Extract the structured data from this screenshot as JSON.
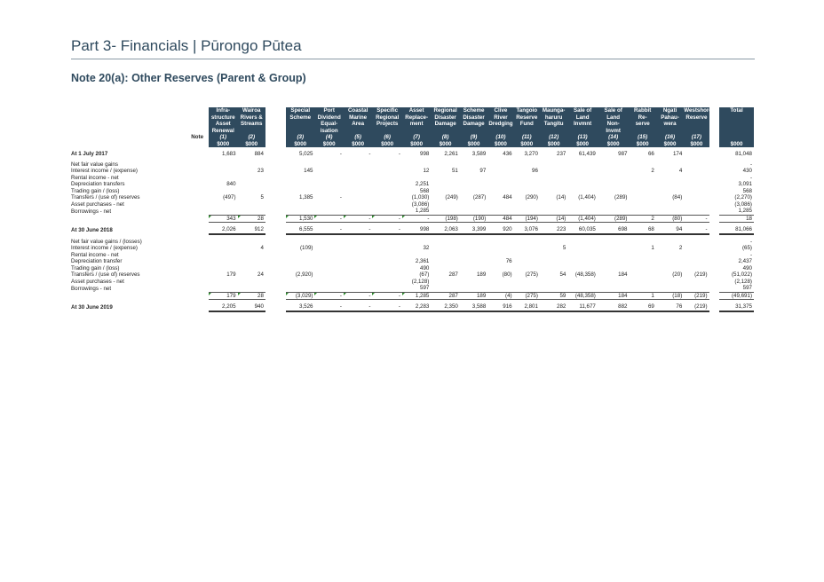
{
  "page_title": "Part 3- Financials | Pūrongo Pūtea",
  "note_title": "Note 20(a):  Other Reserves (Parent & Group)",
  "note_label": "Note",
  "columns": [
    {
      "h1": "Infra-",
      "h2": "structure",
      "h3": "Asset",
      "h4": "Renewal",
      "no": "(1)",
      "unit": "$000"
    },
    {
      "h1": "Wairoa",
      "h2": "Rivers &",
      "h3": "Streams",
      "h4": "",
      "no": "(2)",
      "unit": "$000"
    },
    {
      "h1": "Special",
      "h2": "Scheme",
      "h3": "",
      "h4": "",
      "no": "(3)",
      "unit": "$000"
    },
    {
      "h1": "Port",
      "h2": "Dividend",
      "h3": "Equal-",
      "h4": "isation",
      "no": "(4)",
      "unit": "$000"
    },
    {
      "h1": "Coastal",
      "h2": "Marine",
      "h3": "Area",
      "h4": "",
      "no": "(5)",
      "unit": "$000"
    },
    {
      "h1": "Specific",
      "h2": "Regional",
      "h3": "Projects",
      "h4": "",
      "no": "(6)",
      "unit": "$000"
    },
    {
      "h1": "Asset",
      "h2": "Replace-",
      "h3": "ment",
      "h4": "",
      "no": "(7)",
      "unit": "$000"
    },
    {
      "h1": "Regional",
      "h2": "Disaster",
      "h3": "Damage",
      "h4": "",
      "no": "(8)",
      "unit": "$000"
    },
    {
      "h1": "Scheme",
      "h2": "Disaster",
      "h3": "Damage",
      "h4": "",
      "no": "(9)",
      "unit": "$000"
    },
    {
      "h1": "Clive",
      "h2": "River",
      "h3": "Dredging",
      "h4": "",
      "no": "(10)",
      "unit": "$000"
    },
    {
      "h1": "Tangoio",
      "h2": "Reserve",
      "h3": "Fund",
      "h4": "",
      "no": "(11)",
      "unit": "$000"
    },
    {
      "h1": "Maunga-",
      "h2": "haruru",
      "h3": "Tangitu",
      "h4": "",
      "no": "(12)",
      "unit": "$000"
    },
    {
      "h1": "Sale of",
      "h2": "Land",
      "h3": "Invmnt",
      "h4": "",
      "no": "(13)",
      "unit": "$000"
    },
    {
      "h1": "Sale of",
      "h2": "Land",
      "h3": "Non-",
      "h4": "Invmt",
      "no": "(14)",
      "unit": "$000"
    },
    {
      "h1": "Rabbit",
      "h2": "Re-",
      "h3": "serve",
      "h4": "",
      "no": "(15)",
      "unit": "$000"
    },
    {
      "h1": "Ngati",
      "h2": "Pahau-",
      "h3": "wera",
      "h4": "",
      "no": "(16)",
      "unit": "$000"
    },
    {
      "h1": "Westshore",
      "h2": "Reserve",
      "h3": "",
      "h4": "",
      "no": "(17)",
      "unit": "$000"
    },
    {
      "h1": "Total",
      "h2": "",
      "h3": "",
      "h4": "",
      "no": "",
      "unit": "$000"
    }
  ],
  "rows": [
    {
      "type": "open",
      "label": "At 1 July 2017",
      "v": [
        "1,683",
        "884",
        "5,025",
        "-",
        "-",
        "-",
        "998",
        "2,261",
        "3,589",
        "436",
        "3,270",
        "237",
        "61,439",
        "987",
        "66",
        "174",
        "",
        "81,048"
      ]
    },
    {
      "type": "spacer"
    },
    {
      "type": "item",
      "label": "Net fair value gains",
      "v": [
        "",
        "",
        "",
        "",
        "",
        "",
        "",
        "",
        "",
        "",
        "",
        "",
        "",
        "",
        "",
        "",
        "",
        "-"
      ]
    },
    {
      "type": "item",
      "label": "Interest income / (expense)",
      "v": [
        "",
        "23",
        "145",
        "",
        "",
        "",
        "12",
        "51",
        "97",
        "",
        "96",
        "",
        "",
        "",
        "2",
        "4",
        "",
        "430"
      ]
    },
    {
      "type": "item",
      "label": "Rental income - net",
      "v": [
        "",
        "",
        "",
        "",
        "",
        "",
        "",
        "",
        "",
        "",
        "",
        "",
        "",
        "",
        "",
        "",
        "",
        "-"
      ]
    },
    {
      "type": "item",
      "label": "Depreciation transfers",
      "v": [
        "840",
        "",
        "",
        "",
        "",
        "",
        "2,251",
        "",
        "",
        "",
        "",
        "",
        "",
        "",
        "",
        "",
        "",
        "3,091"
      ]
    },
    {
      "type": "item",
      "label": "Trading gain / (loss)",
      "v": [
        "",
        "",
        "",
        "",
        "",
        "",
        "568",
        "",
        "",
        "",
        "",
        "",
        "",
        "",
        "",
        "",
        "",
        "568"
      ]
    },
    {
      "type": "item",
      "label": "Transfers / (use of) reserves",
      "v": [
        "(497)",
        "5",
        "1,385",
        "-",
        "",
        "",
        "(1,030)",
        "(249)",
        "(287)",
        "484",
        "(290)",
        "(14)",
        "(1,404)",
        "(289)",
        "",
        "(84)",
        "",
        "(2,270)"
      ]
    },
    {
      "type": "item",
      "label": "Asset purchases - net",
      "v": [
        "",
        "",
        "",
        "",
        "",
        "",
        "(3,086)",
        "",
        "",
        "",
        "",
        "",
        "",
        "",
        "",
        "",
        "",
        "(3,086)"
      ]
    },
    {
      "type": "item",
      "label": "Borrowings - net",
      "v": [
        "",
        "",
        "",
        "",
        "",
        "",
        "1,285",
        "",
        "",
        "",
        "",
        "",
        "",
        "",
        "",
        "",
        "",
        "1,285"
      ]
    },
    {
      "type": "sub",
      "label": "",
      "v": [
        "343",
        "28",
        "1,530",
        "-",
        "-",
        "-",
        "-",
        "(198)",
        "(190)",
        "484",
        "(194)",
        "(14)",
        "(1,404)",
        "(289)",
        "2",
        "(80)",
        "-",
        "18"
      ]
    },
    {
      "type": "spacer"
    },
    {
      "type": "tot",
      "label": "At 30 June 2018",
      "v": [
        "2,026",
        "912",
        "6,555",
        "-",
        "-",
        "-",
        "998",
        "2,063",
        "3,399",
        "920",
        "3,076",
        "223",
        "60,035",
        "698",
        "68",
        "94",
        "-",
        "81,066"
      ]
    },
    {
      "type": "spacer"
    },
    {
      "type": "item",
      "label": "Net fair value gains / (losses)",
      "v": [
        "",
        "",
        "",
        "",
        "",
        "",
        "",
        "",
        "",
        "",
        "",
        "",
        "",
        "",
        "",
        "",
        "",
        "-"
      ]
    },
    {
      "type": "item",
      "label": "Interest income / (expense)",
      "v": [
        "",
        "4",
        "(109)",
        "",
        "",
        "",
        "32",
        "",
        "",
        "",
        "",
        "5",
        "",
        "",
        "1",
        "2",
        "",
        "(65)"
      ]
    },
    {
      "type": "item",
      "label": "Rental income - net",
      "v": [
        "",
        "",
        "",
        "",
        "",
        "",
        "",
        "",
        "",
        "",
        "",
        "",
        "",
        "",
        "",
        "",
        "",
        "-"
      ]
    },
    {
      "type": "item",
      "label": "Depreciation transfer",
      "v": [
        "",
        "",
        "",
        "",
        "",
        "",
        "2,361",
        "",
        "",
        "76",
        "",
        "",
        "",
        "",
        "",
        "",
        "",
        "2,437"
      ]
    },
    {
      "type": "item",
      "label": "Trading gain / (loss)",
      "v": [
        "",
        "",
        "",
        "",
        "",
        "",
        "490",
        "",
        "",
        "",
        "",
        "",
        "",
        "",
        "",
        "",
        "",
        "490"
      ]
    },
    {
      "type": "item",
      "label": "Transfers / (use of) reserves",
      "v": [
        "179",
        "24",
        "(2,920)",
        "",
        "",
        "",
        "(67)",
        "287",
        "189",
        "(80)",
        "(275)",
        "54",
        "(48,358)",
        "184",
        "",
        "(20)",
        "(219)",
        "(51,022)"
      ]
    },
    {
      "type": "item",
      "label": "Asset purchases - net",
      "v": [
        "",
        "",
        "",
        "",
        "",
        "",
        "(2,128)",
        "",
        "",
        "",
        "",
        "",
        "",
        "",
        "",
        "",
        "",
        "(2,128)"
      ]
    },
    {
      "type": "item",
      "label": "Borrowings - net",
      "v": [
        "",
        "",
        "",
        "",
        "",
        "",
        "597",
        "",
        "",
        "",
        "",
        "",
        "",
        "",
        "",
        "",
        "",
        "597"
      ]
    },
    {
      "type": "sub",
      "label": "",
      "v": [
        "179",
        "28",
        "(3,029)",
        "-",
        "-",
        "-",
        "1,285",
        "287",
        "189",
        "(4)",
        "(275)",
        "59",
        "(48,358)",
        "184",
        "1",
        "(18)",
        "(219)",
        "(49,691)"
      ]
    },
    {
      "type": "spacer"
    },
    {
      "type": "tot",
      "label": "At 30 June 2019",
      "v": [
        "2,205",
        "940",
        "3,526",
        "-",
        "-",
        "-",
        "2,283",
        "2,350",
        "3,588",
        "916",
        "2,801",
        "282",
        "11,677",
        "882",
        "69",
        "76",
        "(219)",
        "31,375"
      ]
    }
  ]
}
